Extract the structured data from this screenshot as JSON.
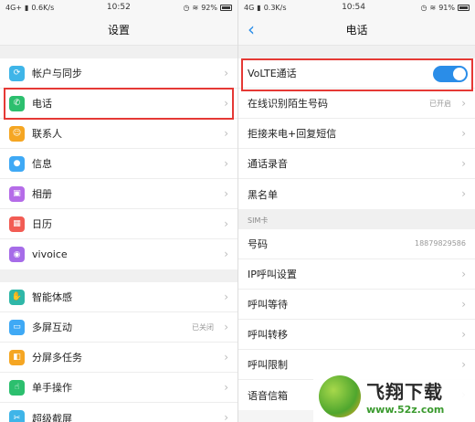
{
  "left": {
    "status": {
      "carrier": "4G+",
      "speed": "0.6K/s",
      "time": "10:52",
      "battery": "92%"
    },
    "title": "设置",
    "groups": [
      {
        "items": [
          {
            "label": "帐户与同步",
            "icon": "account-sync-icon",
            "color": "#3fb5e8"
          },
          {
            "label": "电话",
            "icon": "phone-icon",
            "color": "#2cbf6e"
          },
          {
            "label": "联系人",
            "icon": "contacts-icon",
            "color": "#f5a623"
          },
          {
            "label": "信息",
            "icon": "message-icon",
            "color": "#3fa9f5"
          },
          {
            "label": "相册",
            "icon": "album-icon",
            "color": "#b56ce8"
          },
          {
            "label": "日历",
            "icon": "calendar-icon",
            "color": "#f25c54"
          },
          {
            "label": "vivoice",
            "icon": "voice-icon",
            "color": "#a66ce8"
          }
        ]
      },
      {
        "items": [
          {
            "label": "智能体感",
            "icon": "smart-motion-icon",
            "color": "#2fb7a8"
          },
          {
            "label": "多屏互动",
            "icon": "multiscreen-icon",
            "color": "#3fa9f5",
            "status": "已关闭"
          },
          {
            "label": "分屏多任务",
            "icon": "split-screen-icon",
            "color": "#f5a623"
          },
          {
            "label": "单手操作",
            "icon": "one-hand-icon",
            "color": "#2cbf6e"
          },
          {
            "label": "超级截屏",
            "icon": "screenshot-icon",
            "color": "#3fb5e8"
          }
        ]
      }
    ]
  },
  "right": {
    "status": {
      "carrier": "4G",
      "speed": "0.3K/s",
      "time": "10:54",
      "battery": "91%"
    },
    "title": "电话",
    "volte": {
      "label": "VoLTE通话",
      "enabled": true
    },
    "items": [
      {
        "label": "在线识别陌生号码",
        "status": "已开启"
      },
      {
        "label": "拒接来电+回复短信"
      },
      {
        "label": "通话录音"
      },
      {
        "label": "黑名单"
      }
    ],
    "sim_section": "SIM卡",
    "sim_items": [
      {
        "label": "号码",
        "value": "18879829586"
      },
      {
        "label": "IP呼叫设置"
      },
      {
        "label": "呼叫等待"
      },
      {
        "label": "呼叫转移"
      },
      {
        "label": "呼叫限制"
      },
      {
        "label": "语音信箱"
      }
    ]
  },
  "watermark": {
    "name": "飞翔下载",
    "url": "www.52z.com"
  },
  "colors": {
    "accent": "#2a8de8",
    "highlight": "#e53935"
  }
}
